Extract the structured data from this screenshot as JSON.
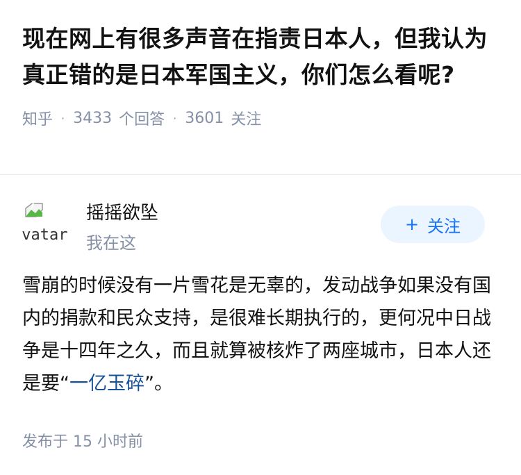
{
  "question": {
    "title": "现在网上有很多声音在指责日本人，但我认为真正错的是日本军国主义，你们怎么看呢?",
    "source": "知乎",
    "answer_count": "3433",
    "answer_label": "个回答",
    "follower_count": "3601",
    "follower_label": "关注",
    "separator": "·"
  },
  "answer": {
    "author": {
      "name": "摇摇欲坠",
      "bio": "我在这",
      "avatar_alt": "avatar"
    },
    "follow_button": {
      "plus": "+",
      "label": "关注"
    },
    "content_before": "雪崩的时候没有一片雪花是无辜的，发动战争如果没有国内的捐款和民众支持，是很难长期执行的，更何况中日战争是十四年之久，而且就算被核炸了两座城市，日本人还是要“",
    "content_link": "一亿玉碎",
    "content_after": "”。",
    "publish_prefix": "发布于",
    "publish_time": "15 小时前"
  },
  "colors": {
    "title": "#121212",
    "meta": "#8590a6",
    "follow_bg": "#ebf5ff",
    "follow_text": "#1772f6",
    "link": "#175199"
  }
}
